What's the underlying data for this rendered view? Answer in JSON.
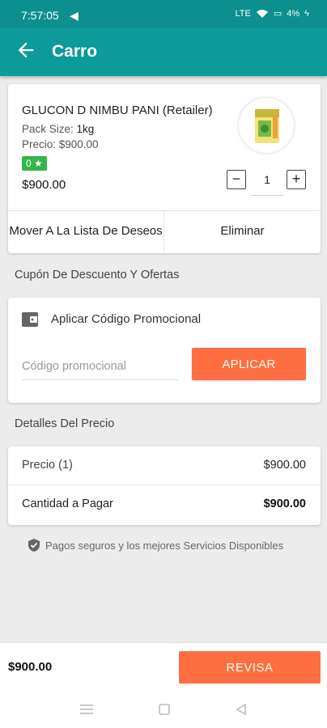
{
  "status_bar": {
    "time": "7:57:05",
    "network": "LTE",
    "battery": "4%"
  },
  "app_bar": {
    "title": "Carro"
  },
  "product": {
    "name": "GLUCON D NIMBU PANI (Retailer)",
    "pack_size_label": "Pack Size:",
    "pack_size_value": "1kg",
    "price_line": "Precio: $900.00",
    "rating": "0 ★",
    "total": "$900.00",
    "quantity": "1",
    "actions": {
      "wishlist": "Mover A La Lista De Deseos",
      "remove": "Eliminar"
    }
  },
  "coupon_section": {
    "heading": "Cupón De Descuento Y Ofertas",
    "title": "Aplicar Código Promocional",
    "placeholder": "Código promocional",
    "apply_label": "APLICAR"
  },
  "price_details": {
    "heading": "Detalles Del Precio",
    "rows": [
      {
        "label": "Precio (1)",
        "value": "$900.00"
      },
      {
        "label": "Cantidad a Pagar",
        "value": "$900.00"
      }
    ]
  },
  "secure_note": "Pagos seguros y los mejores Servicios Disponibles",
  "bottom_bar": {
    "total": "$900.00",
    "checkout_label": "REVISA"
  },
  "colors": {
    "primary": "#0d9a9a",
    "accent": "#ff6e40",
    "rating_badge": "#35b44a"
  }
}
